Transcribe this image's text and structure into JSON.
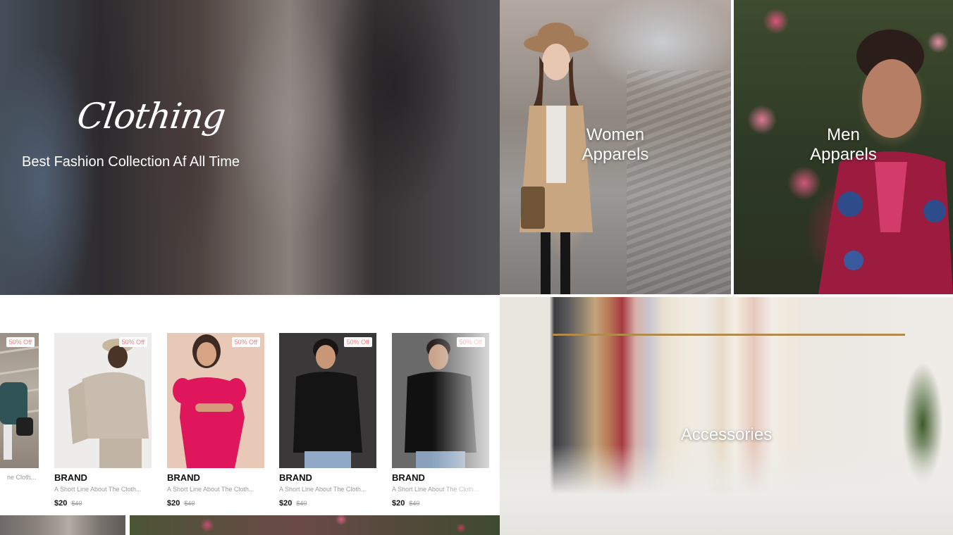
{
  "hero": {
    "script_title": "Clothing",
    "tagline": "Best Fashion Collection Af All Time"
  },
  "categories": {
    "women": "Women\nApparels",
    "men": "Men\nApparels",
    "accessories": "Accessories"
  },
  "products": [
    {
      "badge": "50% Off",
      "brand": "",
      "desc": "ne Cloth...",
      "price": "",
      "old_price": ""
    },
    {
      "badge": "50% Off",
      "brand": "BRAND",
      "desc": "A Short Line About The Cloth...",
      "price": "$20",
      "old_price": "$40"
    },
    {
      "badge": "50% Off",
      "brand": "BRAND",
      "desc": "A Short Line About The Cloth...",
      "price": "$20",
      "old_price": "$40"
    },
    {
      "badge": "50% Off",
      "brand": "BRAND",
      "desc": "A Short Line About The Cloth...",
      "price": "$20",
      "old_price": "$40"
    },
    {
      "badge": "50% Off",
      "brand": "BRAND",
      "desc": "A Short Line About The Cloth...",
      "price": "$20",
      "old_price": "$40"
    }
  ],
  "colors": {
    "badge_text": "#f37a7a",
    "text_primary": "#111111",
    "text_muted": "#9a9a9a"
  }
}
